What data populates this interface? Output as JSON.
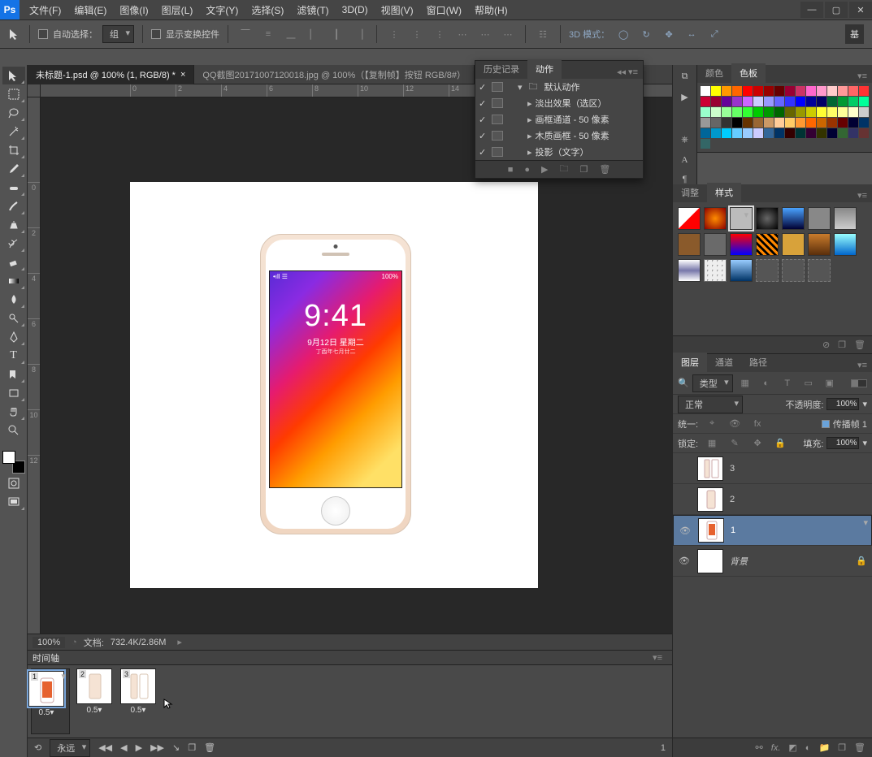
{
  "titlebar": {
    "logo": "Ps"
  },
  "menu": [
    "文件(F)",
    "编辑(E)",
    "图像(I)",
    "图层(L)",
    "文字(Y)",
    "选择(S)",
    "滤镜(T)",
    "3D(D)",
    "视图(V)",
    "窗口(W)",
    "帮助(H)"
  ],
  "options": {
    "auto_select": "自动选择：",
    "group": "组",
    "show_transform": "显示变换控件",
    "mode3d": "3D 模式：",
    "basic": "基"
  },
  "tabs": {
    "t1": "未标题-1.psd @ 100% (1, RGB/8) *",
    "t2": "QQ截图20171007120018.jpg @ 100%（【复制帧】按钮  RGB/8#）"
  },
  "ruler_h": [
    "0",
    "2",
    "4",
    "6",
    "8",
    "10",
    "12",
    "14"
  ],
  "ruler_v": [
    "0",
    "2",
    "4",
    "6",
    "8",
    "10",
    "12"
  ],
  "phone": {
    "time": "9:41",
    "date": "9月12日 星期二",
    "sub": "丁酉年七月廿二",
    "battery": "100%"
  },
  "status": {
    "zoom": "100%",
    "doc_label": "文档:",
    "doc": "732.4K/2.86M"
  },
  "timeline": {
    "title": "时间轴",
    "dur": "0.5▾",
    "loop_label": "永远",
    "footer_num": "1"
  },
  "actions": {
    "tab_history": "历史记录",
    "tab_actions": "动作",
    "items": [
      "默认动作",
      "淡出效果（选区）",
      "画框通道 - 50 像素",
      "木质画框 - 50 像素",
      "投影（文字）"
    ]
  },
  "color_panel": {
    "tab_color": "颜色",
    "tab_swatch": "色板"
  },
  "swatch_colors": [
    "#fff",
    "#ff0",
    "#f90",
    "#f60",
    "#f00",
    "#c00",
    "#900",
    "#600",
    "#903",
    "#c36",
    "#f6c",
    "#f9c",
    "#fcc",
    "#f99",
    "#f66",
    "#f33",
    "#c03",
    "#903",
    "#609",
    "#93c",
    "#c6f",
    "#ccf",
    "#99f",
    "#66f",
    "#33f",
    "#00f",
    "#009",
    "#006",
    "#063",
    "#093",
    "#0c6",
    "#0f9",
    "#9fc",
    "#cfc",
    "#9f9",
    "#6f6",
    "#3f3",
    "#0c0",
    "#090",
    "#060",
    "#660",
    "#990",
    "#cc0",
    "#ff3",
    "#ff6",
    "#ff9",
    "#ffc",
    "#ccc",
    "#999",
    "#666",
    "#333",
    "#000",
    "#630",
    "#963",
    "#c96",
    "#fc9",
    "#fc6",
    "#f93",
    "#f60",
    "#c60",
    "#930",
    "#600",
    "#003",
    "#036",
    "#069",
    "#09c",
    "#0cf",
    "#6cf",
    "#9cf",
    "#ccf",
    "#369",
    "#036",
    "#300",
    "#033",
    "#303",
    "#330",
    "#003",
    "#363",
    "#336",
    "#633",
    "#366"
  ],
  "adjust_panel": {
    "tab_adjust": "调整",
    "tab_style": "样式"
  },
  "layers_panel": {
    "tab_layers": "图层",
    "tab_channels": "通道",
    "tab_paths": "路径",
    "kind_label": "类型",
    "blend": "正常",
    "opacity_label": "不透明度:",
    "opacity": "100%",
    "unify_label": "统一:",
    "propagate": "传播帧 1",
    "lock_label": "锁定:",
    "fill_label": "填充:",
    "fill": "100%",
    "items": [
      {
        "name": "3",
        "vis": false
      },
      {
        "name": "2",
        "vis": false
      },
      {
        "name": "1",
        "vis": true,
        "sel": true
      },
      {
        "name": "背景",
        "vis": true,
        "lock": true,
        "italic": true
      }
    ]
  }
}
